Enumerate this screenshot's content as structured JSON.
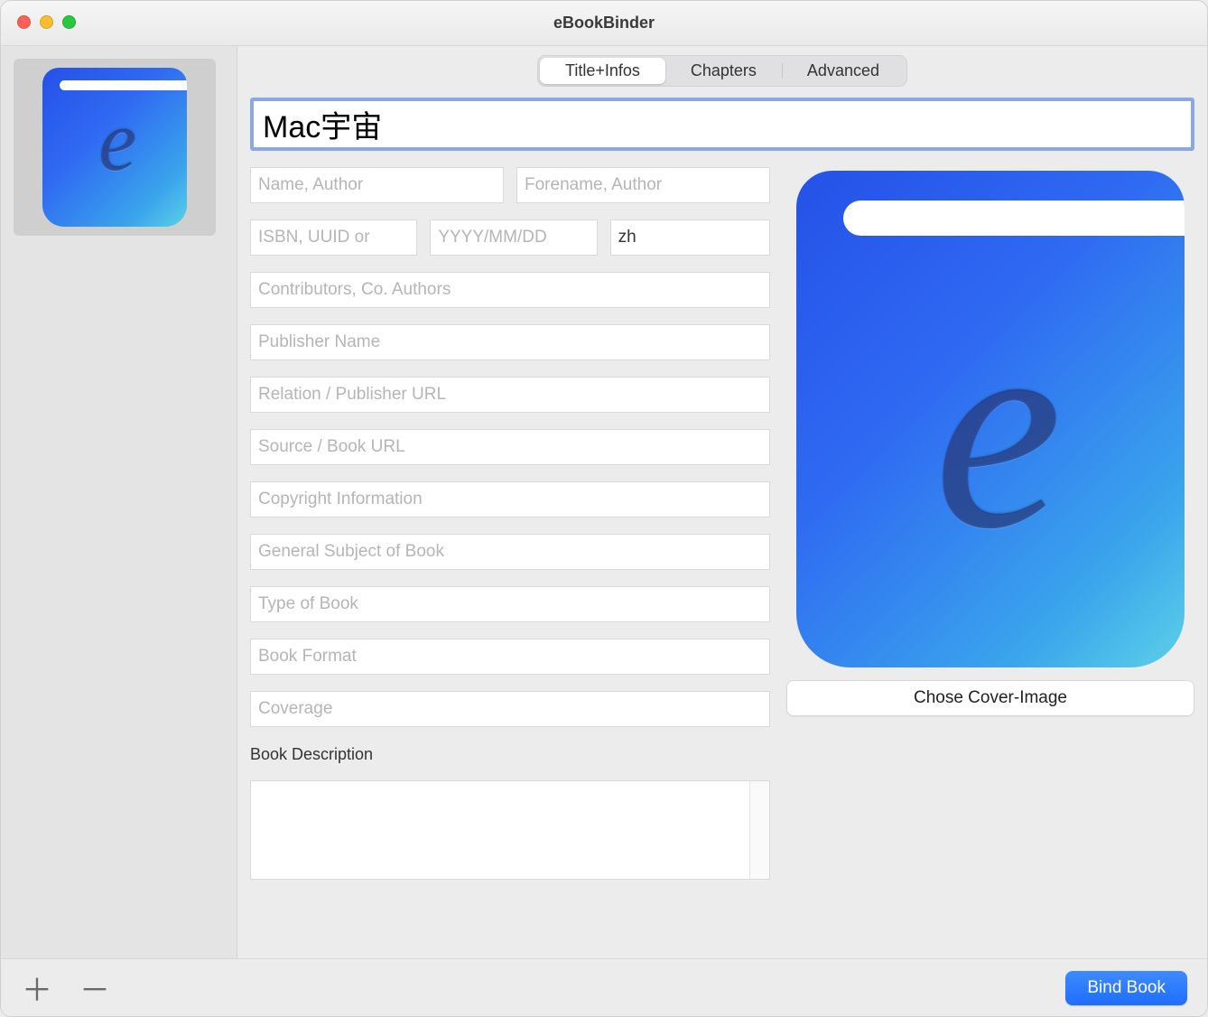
{
  "window": {
    "title": "eBookBinder"
  },
  "tabs": {
    "title_infos": "Title+Infos",
    "chapters": "Chapters",
    "advanced": "Advanced",
    "active": "title_infos"
  },
  "form": {
    "title_value": "Mac宇宙",
    "author_name_placeholder": "Name, Author",
    "author_forename_placeholder": "Forename, Author",
    "isbn_placeholder": "ISBN, UUID or",
    "date_placeholder": "YYYY/MM/DD",
    "language_value": "zh",
    "contributors_placeholder": "Contributors, Co. Authors",
    "publisher_placeholder": "Publisher Name",
    "relation_placeholder": "Relation / Publisher URL",
    "source_placeholder": "Source / Book URL",
    "copyright_placeholder": "Copyright Information",
    "subject_placeholder": "General Subject of Book",
    "type_placeholder": "Type of Book",
    "format_placeholder": "Book Format",
    "coverage_placeholder": "Coverage",
    "description_label": "Book Description"
  },
  "cover": {
    "choose_button": "Chose Cover-Image"
  },
  "footer": {
    "bind_button": "Bind Book"
  }
}
